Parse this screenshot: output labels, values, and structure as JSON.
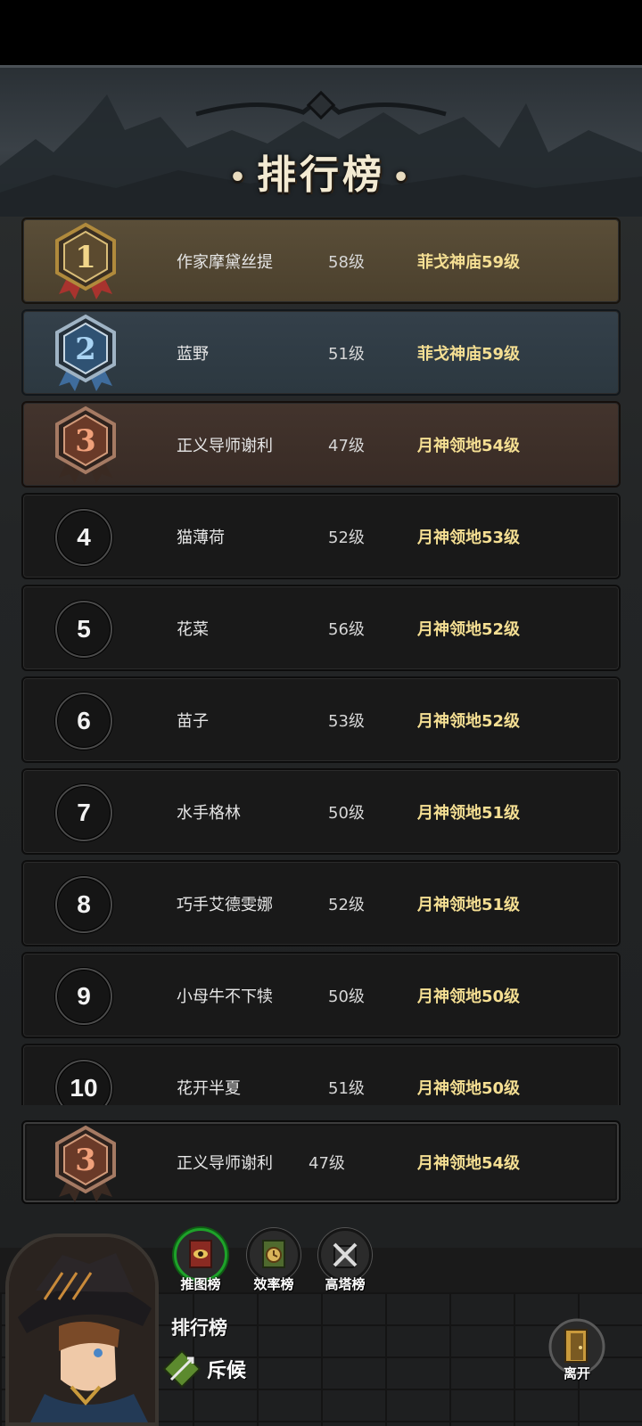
{
  "header": {
    "title": "排行榜"
  },
  "rankings": [
    {
      "rank": "1",
      "name": "作家摩黛丝提",
      "level": "58级",
      "stage": "菲戈神庙59级"
    },
    {
      "rank": "2",
      "name": "蓝野",
      "level": "51级",
      "stage": "菲戈神庙59级"
    },
    {
      "rank": "3",
      "name": "正义导师谢利",
      "level": "47级",
      "stage": "月神领地54级"
    },
    {
      "rank": "4",
      "name": "猫薄荷",
      "level": "52级",
      "stage": "月神领地53级"
    },
    {
      "rank": "5",
      "name": "花菜",
      "level": "56级",
      "stage": "月神领地52级"
    },
    {
      "rank": "6",
      "name": "苗子",
      "level": "53级",
      "stage": "月神领地52级"
    },
    {
      "rank": "7",
      "name": "水手格林",
      "level": "50级",
      "stage": "月神领地51级"
    },
    {
      "rank": "8",
      "name": "巧手艾德雯娜",
      "level": "52级",
      "stage": "月神领地51级"
    },
    {
      "rank": "9",
      "name": "小母牛不下犊",
      "level": "50级",
      "stage": "月神领地50级"
    },
    {
      "rank": "10",
      "name": "花开半夏",
      "level": "51级",
      "stage": "月神领地50级"
    }
  ],
  "self_row": {
    "rank": "3",
    "name": "正义导师谢利",
    "level": "47级",
    "stage": "月神领地54级"
  },
  "tabs": [
    {
      "label": "推图榜",
      "icon": "banner-eye-icon",
      "active": true
    },
    {
      "label": "效率榜",
      "icon": "banner-clock-icon",
      "active": false
    },
    {
      "label": "高塔榜",
      "icon": "crossed-swords-icon",
      "active": false
    }
  ],
  "footer": {
    "title": "排行榜",
    "scout_label": "斥候",
    "exit_label": "离开"
  },
  "colors": {
    "gold": "#b08a3c",
    "silver": "#7fa7c8",
    "bronze": "#b16a45",
    "stage_text": "#f5df93",
    "active_tab": "#1ea22a"
  }
}
